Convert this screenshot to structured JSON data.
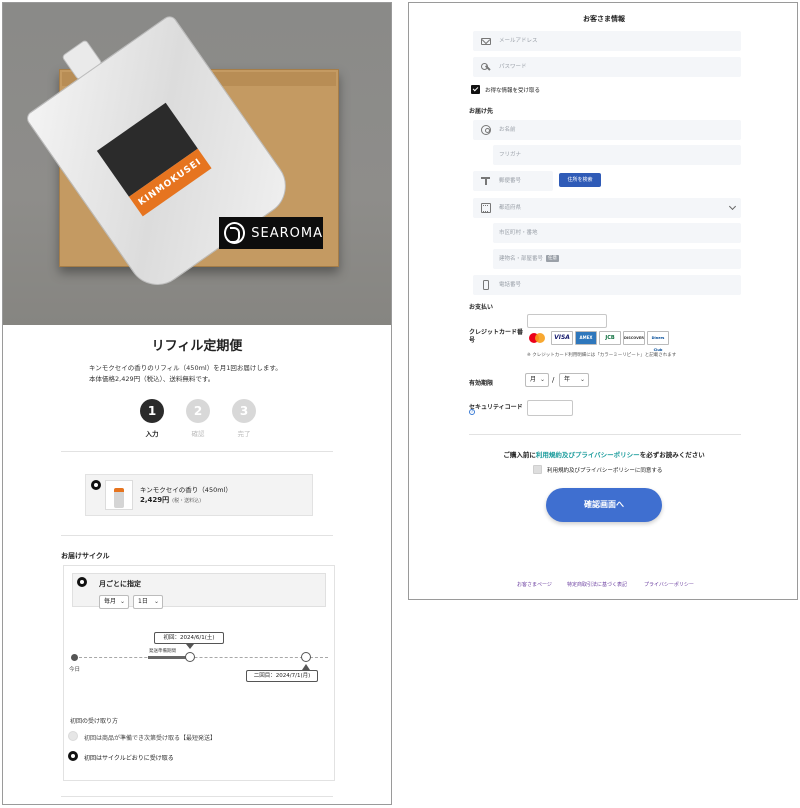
{
  "left": {
    "hero": {
      "pouch_brand": "KINMOKUSEI",
      "logo_text": "SEAROMA"
    },
    "title": "リフィル定期便",
    "description": [
      "キンモクセイの香りのリフィル（450ml）を月1回お届けします。",
      "本体価格2,429円（税込）、送料無料です。"
    ],
    "steps": [
      {
        "number": "1",
        "label": "入力"
      },
      {
        "number": "2",
        "label": "確認"
      },
      {
        "number": "3",
        "label": "完了"
      }
    ],
    "product": {
      "name": "キンモクセイの香り（450ml）",
      "price": "2,429円",
      "price_note": "(税・送料込)"
    },
    "cycle": {
      "title": "お届けサイクル",
      "mode": "月ごとに指定",
      "month_select": "毎月",
      "day_select": "1日",
      "timeline": {
        "today": "今日",
        "prep": "発送準備期間",
        "first": "初回：2024/6/1(土)",
        "second": "二回目：2024/7/1(月)"
      },
      "receive_title": "初回の受け取り方",
      "receive_options": [
        "初回は商品が準備でき次第受け取る【最短発送】",
        "初回はサイクルどおりに受け取る"
      ]
    }
  },
  "right": {
    "title": "お客さま情報",
    "email_placeholder": "メールアドレス",
    "password_placeholder": "パスワード",
    "offer_label": "お得な情報を受け取る",
    "shipping_title": "お届け先",
    "name_placeholder": "お名前",
    "kana_placeholder": "フリガナ",
    "zip_placeholder": "郵便番号",
    "address_search_button": "住所を検索",
    "prefecture_placeholder": "都道府県",
    "city_placeholder": "市区町村・番地",
    "building_placeholder": "建物名・部屋番号",
    "building_badge": "任意",
    "phone_placeholder": "電話番号",
    "payment_title": "お支払い",
    "cc_label": "クレジットカード番号",
    "cards": [
      "VISA",
      "AMEX",
      "JCB",
      "DISCOVER",
      "Diners Club"
    ],
    "cc_note": "※ クレジットカード利用明細には「カラーミーリピート」と記載されます",
    "exp_label": "有効期限",
    "exp_month": "月",
    "exp_year": "年",
    "exp_slash": "/",
    "sec_code_label": "セキュリティコード",
    "sec_code_help": "?",
    "agree_prefix": "ご購入前に",
    "agree_link": "利用規約及びプライバシーポリシー",
    "agree_suffix": "を必ずお読みください",
    "agree_checkbox_label": "利用規約及びプライバシーポリシーに同意する",
    "confirm_button": "確認画面へ",
    "footer_links": [
      "お客さまページ",
      "特定商取引法に基づく表記",
      "プライバシーポリシー"
    ]
  },
  "colors": {
    "primary_button": "#3f6fd0",
    "address_button": "#2f5bb7",
    "agree_link": "#1a9c9c",
    "footer_link": "#6b3fa0",
    "step_active": "#2b2b2b",
    "step_inactive": "#d8d8d8",
    "pouch_orange": "#e6741f"
  }
}
